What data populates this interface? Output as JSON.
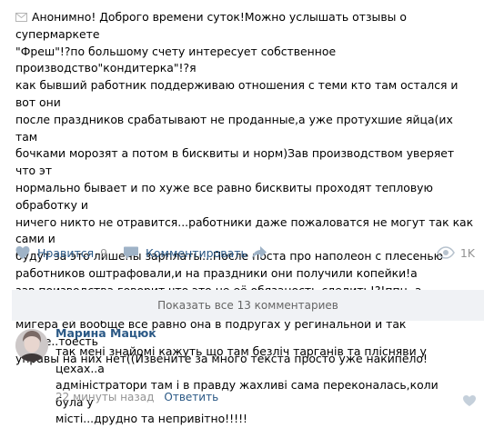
{
  "post": {
    "lines": [
      "Анонимно! Доброго времени суток!Можно услышать отзывы о супермаркете",
      "\"Фреш\"!?по большому счету интересует собственное производство\"кондитерка\"!?я",
      "как бывший работник поддерживаю отношения с теми кто там остался и вот они",
      "после праздников срабатывают не проданные,а уже протухшие яйца(их там",
      "бочками морозят а потом в бисквиты и норм)Зав производством уверяет что эт",
      "нормально бывает и по хуже все равно бисквиты проходят тепловую обработку и",
      "ничего никто не отравится...работники даже пожаловатся не могут так как сами и",
      "будут за это лишены зарплаты...После поста про наполеон с плесенью",
      "работников оштрафовали,и на праздники они получили копейки!а",
      "зав.поизводства говорит что это не её обязаность следить!?!ппц..а Управляющая",
      "мигера ей вообще все равно она в подругах у регинальной и так далее..тоесть",
      "управы на них нет((Извените за много текста просто уже накипело!"
    ]
  },
  "actions": {
    "like_label": "Нравится",
    "like_count": "9",
    "comment_label": "Комментировать",
    "views_count": "1K"
  },
  "comments_bar": {
    "label": "Показать все 13 комментариев"
  },
  "comment": {
    "author": "Марина Мацюк",
    "lines": [
      "так мені знайомі кажуть що там безліч тарганів та плісняви у цехах..а",
      "адміністратори там і в правду жахливі сама переконалась,коли була у",
      "місті...друдно та непривітно!!!!!"
    ],
    "time": "22 минуты назад",
    "reply_label": "Ответить"
  },
  "colors": {
    "link": "#2a5885",
    "muted": "#939393",
    "icon": "#9fb3c7",
    "bar_bg": "#f0f2f5"
  }
}
